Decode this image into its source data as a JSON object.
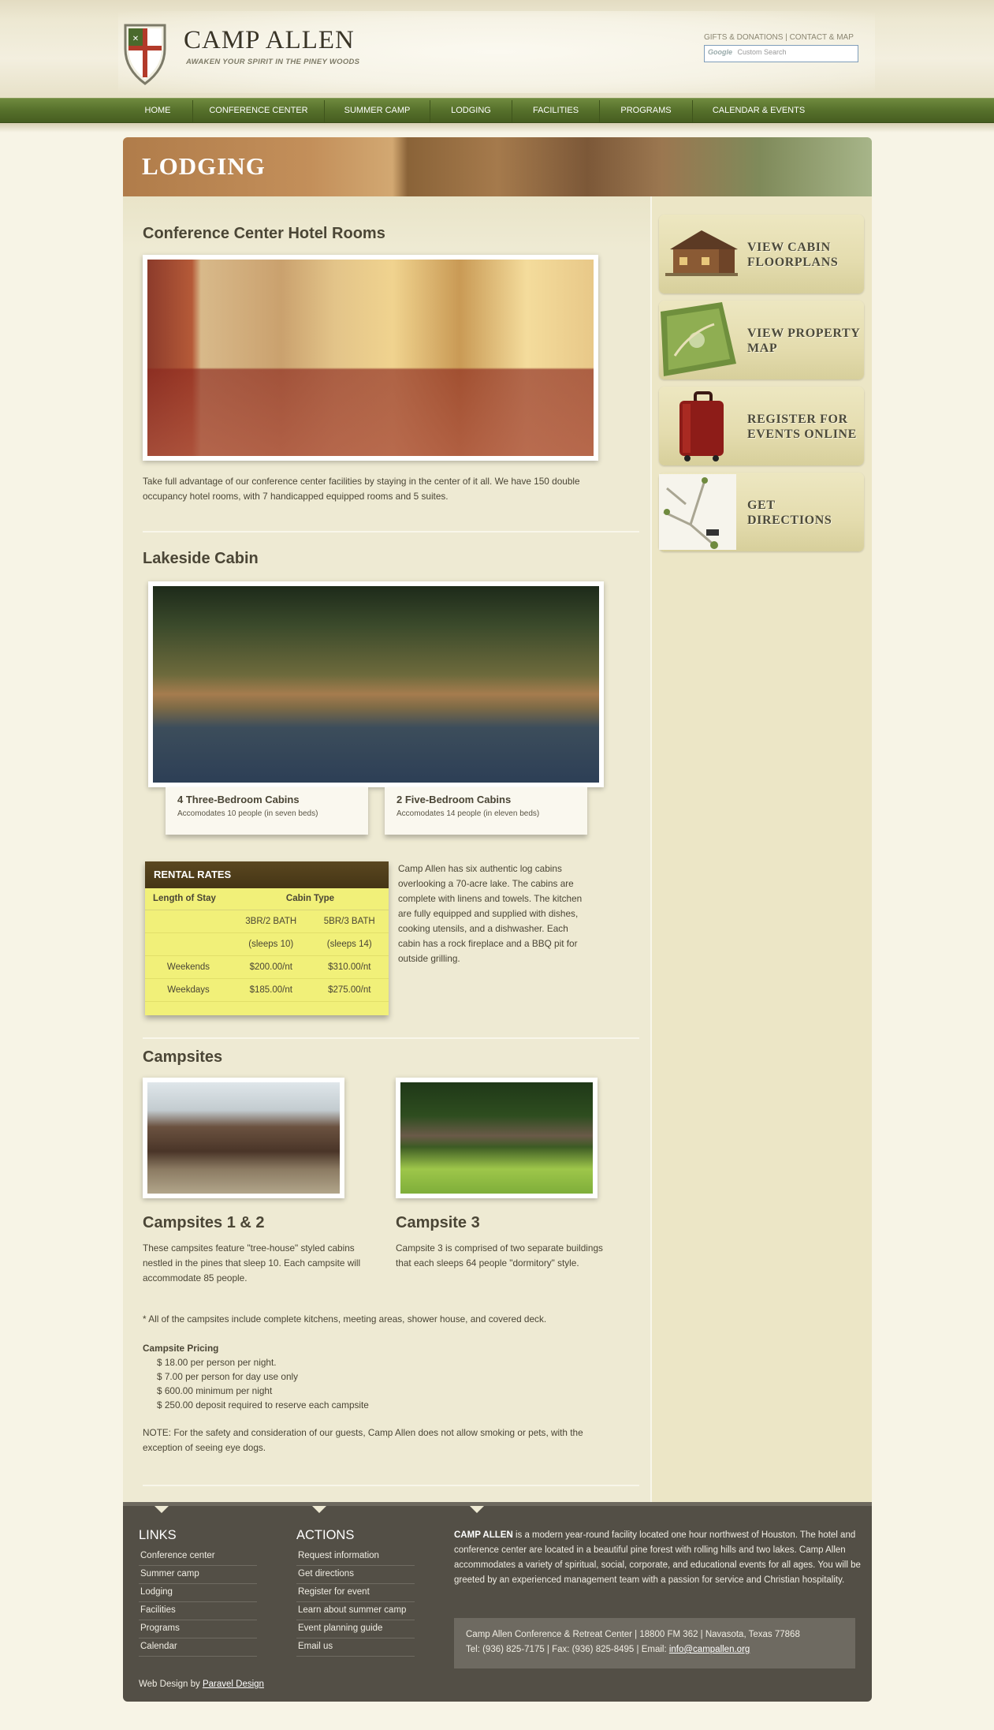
{
  "header": {
    "logo_name": "CAMP ALLEN",
    "logo_tagline": "AWAKEN YOUR SPIRIT IN THE PINEY WOODS",
    "util_gifts": "GIFTS & DONATIONS",
    "util_sep": "|",
    "util_contact": "CONTACT & MAP",
    "search_brand": "Google",
    "search_placeholder": "Custom Search"
  },
  "nav": {
    "items": [
      "HOME",
      "CONFERENCE CENTER",
      "SUMMER CAMP",
      "LODGING",
      "FACILITIES",
      "PROGRAMS",
      "CALENDAR & EVENTS"
    ]
  },
  "banner": {
    "title": "LODGING"
  },
  "hotel": {
    "heading": "Conference Center Hotel Rooms",
    "description": "Take full advantage of our conference center facilities by staying in the center of it all. We have 150 double occupancy hotel rooms, with 7 handicapped equipped rooms and 5 suites."
  },
  "cabin": {
    "heading": "Lakeside Cabin",
    "caption1_title": "4 Three-Bedroom Cabins",
    "caption1_sub": "Accomodates 10 people (in seven beds)",
    "caption2_title": "2 Five-Bedroom Cabins",
    "caption2_sub": "Accomodates 14 people (in eleven beds)",
    "description": "Camp Allen has six authentic log cabins overlooking a 70-acre lake. The cabins are complete with linens and towels. The kitchen are fully equipped and supplied with dishes, cooking utensils, and a dishwasher. Each cabin has a rock fireplace and a BBQ pit for outside grilling."
  },
  "rates": {
    "title": "RENTAL RATES",
    "col_stay": "Length of Stay",
    "col_type": "Cabin Type",
    "rows": [
      [
        "",
        "3BR/2 BATH",
        "5BR/3 BATH"
      ],
      [
        "",
        "(sleeps 10)",
        "(sleeps 14)"
      ],
      [
        "Weekends",
        "$200.00/nt",
        "$310.00/nt"
      ],
      [
        "Weekdays",
        "$185.00/nt",
        "$275.00/nt"
      ]
    ]
  },
  "campsites": {
    "heading": "Campsites",
    "site1_title": "Campsites 1 & 2",
    "site1_desc": "These campsites feature \"tree-house\" styled cabins nestled in the pines that sleep 10. Each campsite will accommodate 85 people.",
    "site2_title": "Campsite 3",
    "site2_desc": "Campsite 3 is comprised of two separate buildings that each sleeps 64 people \"dormitory\" style.",
    "note_all": "* All of the campsites include complete kitchens, meeting areas, shower house, and covered deck.",
    "pricing_title": "Campsite Pricing",
    "pricing": [
      "$ 18.00 per person per night.",
      "$ 7.00 per person for day use only",
      "$ 600.00 minimum per night",
      "$ 250.00 deposit required to reserve each campsite"
    ],
    "note_smoking": "NOTE: For the safety and consideration of our guests, Camp Allen does not allow smoking or pets, with the exception of seeing eye dogs."
  },
  "sidebar": {
    "buttons": [
      {
        "line1": "VIEW CABIN",
        "line2": "FLOORPLANS"
      },
      {
        "line1": "VIEW PROPERTY",
        "line2": "MAP"
      },
      {
        "line1": "REGISTER FOR",
        "line2": "EVENTS ONLINE"
      },
      {
        "line1": "GET",
        "line2": "DIRECTIONS"
      }
    ]
  },
  "footer": {
    "links_head": "LINKS",
    "links": [
      "Conference center",
      "Summer camp",
      "Lodging",
      "Facilities",
      "Programs",
      "Calendar"
    ],
    "actions_head": "ACTIONS",
    "actions": [
      "Request information",
      "Get directions",
      "Register for event",
      "Learn about summer camp",
      "Event planning guide",
      "Email us"
    ],
    "about_bold": "CAMP ALLEN",
    "about_text": " is a modern year-round facility located one hour northwest of Houston. The hotel and conference center are located in a beautiful pine forest with rolling hills and two lakes. Camp Allen accommodates a variety of spiritual, social, corporate, and educational events for all ages. You will be greeted by an experienced management team with a passion for service and Christian hospitality.",
    "address_line1": "Camp Allen Conference & Retreat Center | 18800 FM 362 | Navasota, Texas 77868",
    "address_line2_prefix": "Tel: (936) 825-7175 | Fax: (936) 825-8495 | Email: ",
    "email": "info@campallen.org",
    "credit_prefix": "Web Design by ",
    "credit_link": "Paravel Design"
  },
  "colors": {
    "nav_green": "#56702b",
    "banner_brown": "#b07c4a",
    "rates_yellow": "#f1f079",
    "footer_dark": "#534f46"
  }
}
